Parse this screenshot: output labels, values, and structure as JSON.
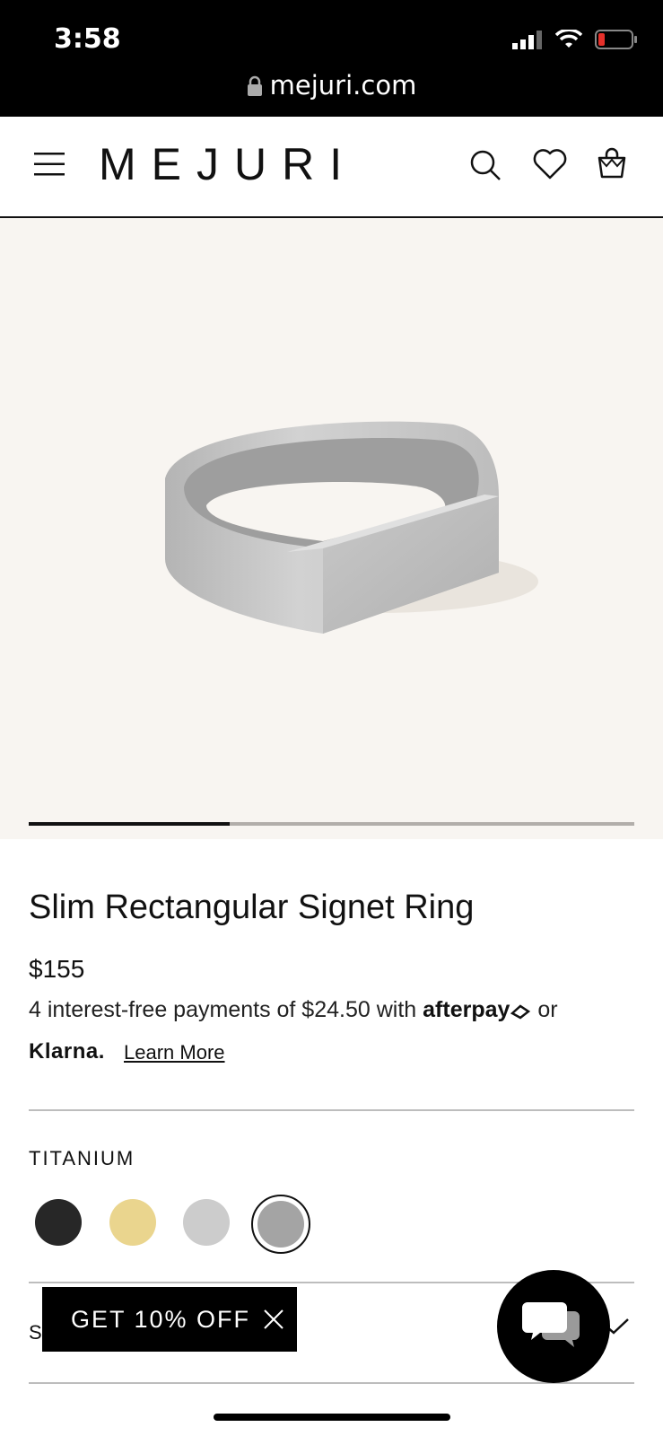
{
  "status_bar": {
    "time": "3:58",
    "url": "mejuri.com"
  },
  "header": {
    "logo": "MEJURI"
  },
  "product": {
    "title": "Slim Rectangular Signet Ring",
    "price": "$155",
    "payments_text": "4 interest-free payments of $24.50 with",
    "afterpay": "afterpay",
    "or": "or",
    "klarna": "Klarna.",
    "learn_more": "Learn More",
    "metal_label": "TITANIUM",
    "gallery_progress": 0.33
  },
  "swatches": [
    {
      "name": "black",
      "color": "#272727"
    },
    {
      "name": "gold",
      "color": "#ead58e"
    },
    {
      "name": "light-silver",
      "color": "#cccccc"
    },
    {
      "name": "gray",
      "color": "#a4a4a4",
      "selected": true
    }
  ],
  "section_letter": "S",
  "promo": {
    "label": "GET 10% OFF"
  }
}
